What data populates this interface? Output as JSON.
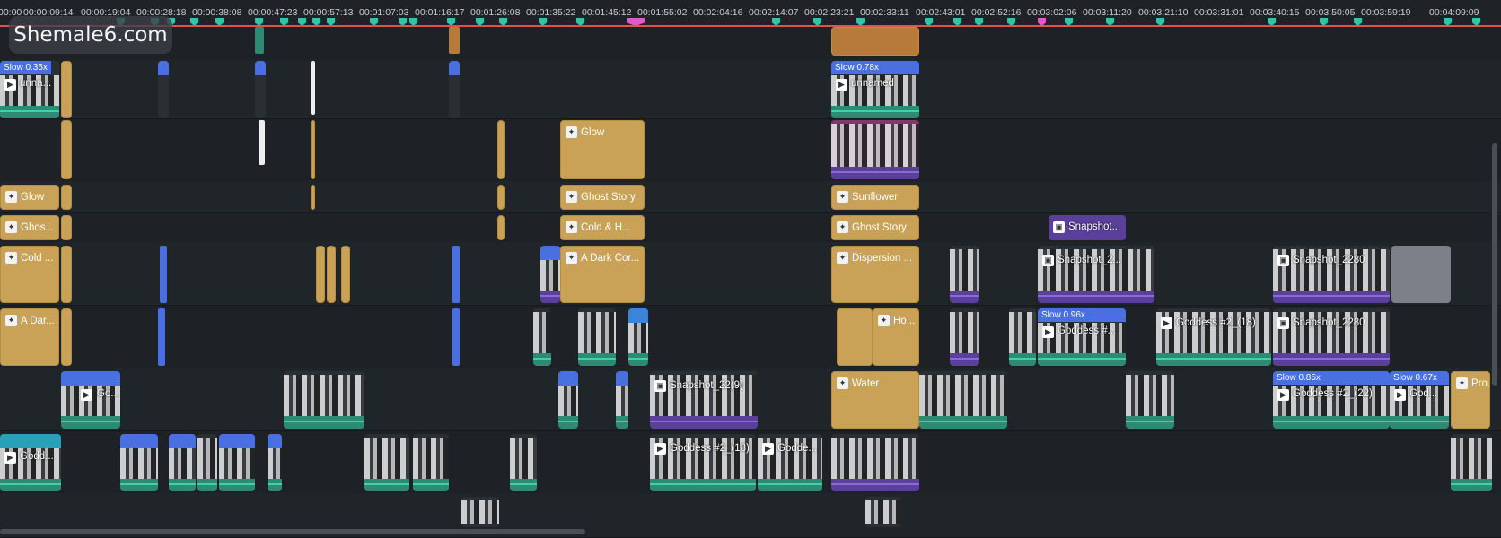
{
  "ruler": {
    "ticks": [
      "00:00",
      "00:00:09:14",
      "00:00:19:04",
      "00:00:28:18",
      "00:00:38:08",
      "00:00:47:23",
      "00:00:57:13",
      "00:01:07:03",
      "00:01:16:17",
      "00:01:26:08",
      "00:01:35:22",
      "00:01:45:12",
      "00:01:55:02",
      "00:02:04:16",
      "00:02:14:07",
      "00:02:23:21",
      "00:02:33:11",
      "00:02:43:01",
      "00:02:52:16",
      "00:03:02:06",
      "00:03:11:20",
      "00:03:21:10",
      "00:03:31:01",
      "00:03:40:15",
      "00:03:50:05",
      "00:03:59:19",
      "00:04:09:09"
    ]
  },
  "watermark": {
    "text": "Shemale6.com"
  },
  "colors": {
    "effect": "#c9a257",
    "video_band": "#1f5a4a",
    "speed_bar": "#4a6fe0",
    "playhead": "#e0524e",
    "marker": "#30c4a8"
  },
  "clips": {
    "slow_035": "Slow 0.35x",
    "unnamed_1": "unna...",
    "slow_078": "Slow 0.78x",
    "unnamed_2": "unnamed",
    "glow_main": "Glow",
    "glow_left": "Glow",
    "ghost_story_1": "Ghost Story",
    "sunflower": "Sunflower",
    "ghos_left": "Ghos...",
    "cold_hot": "Cold & H...",
    "ghost_story_2": "Ghost Story",
    "snapshot_1": "Snapshot...",
    "cold_left": "Cold ...",
    "dark_corner": "A Dark Cor...",
    "dispersion": "Dispersion ...",
    "snapshot_2": "Snapshot_2...",
    "snapshot_3": "Snapshot_2280",
    "a_dark_left": "A Dar...",
    "ho": "Ho...",
    "slow_096": "Slow 0.96x",
    "goddess_1": "Goddess #...",
    "goddess_2": "Goddess #2_(18)",
    "snapshot_4": "Snapshot_2280",
    "go_1": "Go...",
    "snapshot_5": "Snapshot_22(9)",
    "water": "Water",
    "slow_085": "Slow 0.85x",
    "goddess_3": "Goddess #2_(22)",
    "slow_067": "Slow 0.67x",
    "god_1": "God...",
    "pro": "Pro...",
    "godd_left": "Godd...",
    "goddess_4": "Goddess #2_(18)",
    "godde": "Godde..."
  }
}
